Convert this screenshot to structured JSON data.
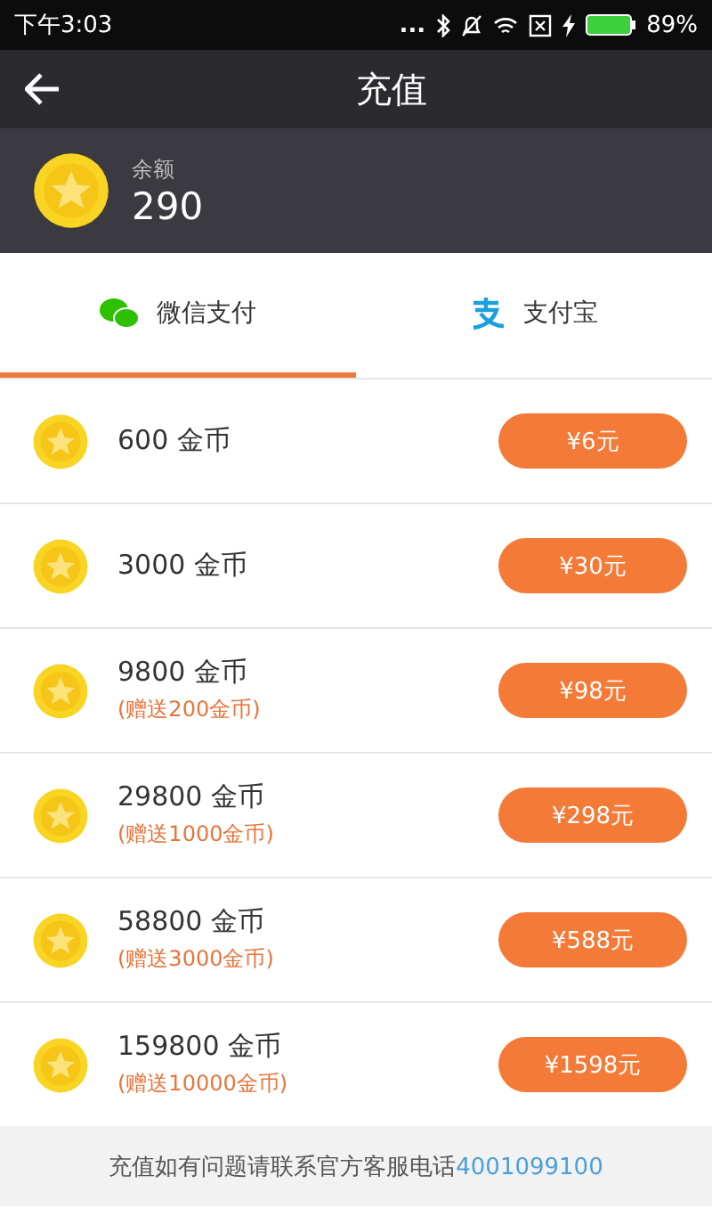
{
  "status_bar": {
    "time": "下午3:03",
    "dots": "...",
    "battery": "89%"
  },
  "header": {
    "title": "充值"
  },
  "balance": {
    "label": "余额",
    "value": "290"
  },
  "tabs": [
    {
      "label": "微信支付",
      "kind": "wechat",
      "selected": true
    },
    {
      "label": "支付宝",
      "kind": "alipay",
      "selected": false
    }
  ],
  "packages": [
    {
      "amount": "600 金币",
      "price": "¥6元"
    },
    {
      "amount": "3000 金币",
      "price": "¥30元"
    },
    {
      "amount": "9800 金币",
      "bonus": "(赠送200金币)",
      "price": "¥98元"
    },
    {
      "amount": "29800 金币",
      "bonus": "(赠送1000金币)",
      "price": "¥298元"
    },
    {
      "amount": "58800 金币",
      "bonus": "(赠送3000金币)",
      "price": "¥588元"
    },
    {
      "amount": "159800 金币",
      "bonus": "(赠送10000金币)",
      "price": "¥1598元"
    }
  ],
  "footer": {
    "text": "充值如有问题请联系官方客服电话",
    "phone": "4001099100"
  }
}
